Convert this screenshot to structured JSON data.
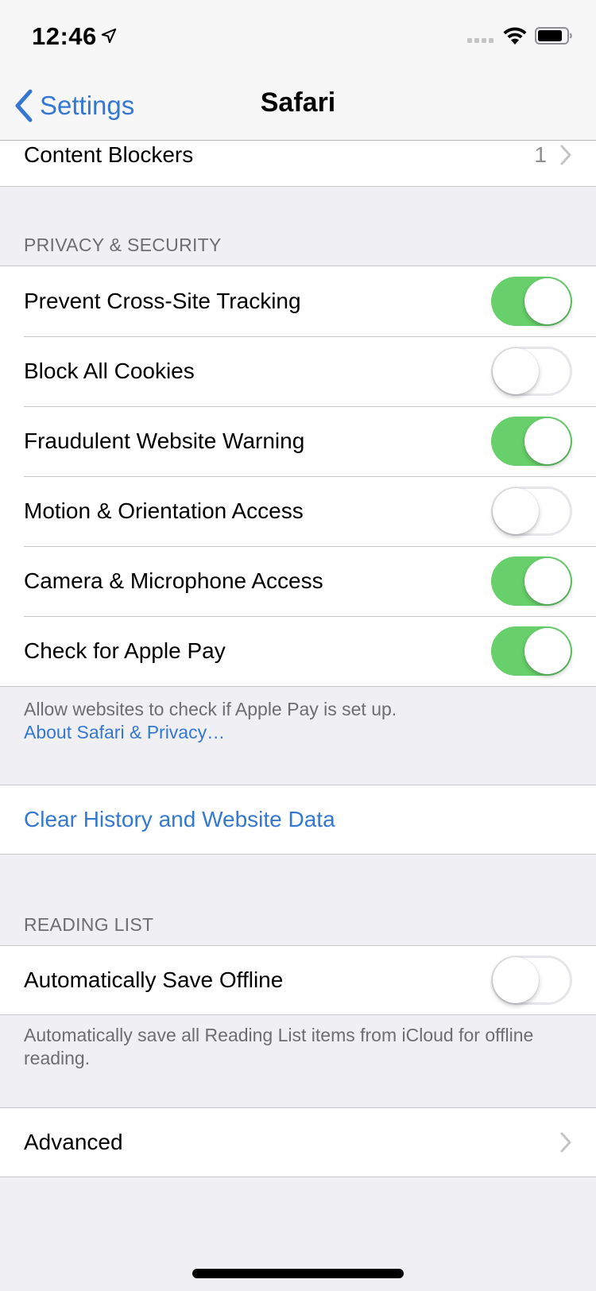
{
  "status_bar": {
    "time": "12:46",
    "icons": [
      "location-arrow-icon",
      "signal-dots-icon",
      "wifi-icon",
      "battery-icon"
    ]
  },
  "nav": {
    "back_label": "Settings",
    "title": "Safari"
  },
  "content_blockers": {
    "label": "Content Blockers",
    "value": "1"
  },
  "privacy": {
    "header": "PRIVACY & SECURITY",
    "items": [
      {
        "label": "Prevent Cross-Site Tracking",
        "on": true
      },
      {
        "label": "Block All Cookies",
        "on": false
      },
      {
        "label": "Fraudulent Website Warning",
        "on": true
      },
      {
        "label": "Motion & Orientation Access",
        "on": false
      },
      {
        "label": "Camera & Microphone Access",
        "on": true
      },
      {
        "label": "Check for Apple Pay",
        "on": true
      }
    ],
    "footer_text": "Allow websites to check if Apple Pay is set up.",
    "footer_link": "About Safari & Privacy…"
  },
  "clear_history": {
    "label": "Clear History and Website Data"
  },
  "reading_list": {
    "header": "READING LIST",
    "item": {
      "label": "Automatically Save Offline",
      "on": false
    },
    "footer_text": "Automatically save all Reading List items from iCloud for offline reading."
  },
  "advanced": {
    "label": "Advanced"
  },
  "colors": {
    "accent": "#3478d4",
    "toggle_on": "#68d06b",
    "background": "#efeff4"
  }
}
